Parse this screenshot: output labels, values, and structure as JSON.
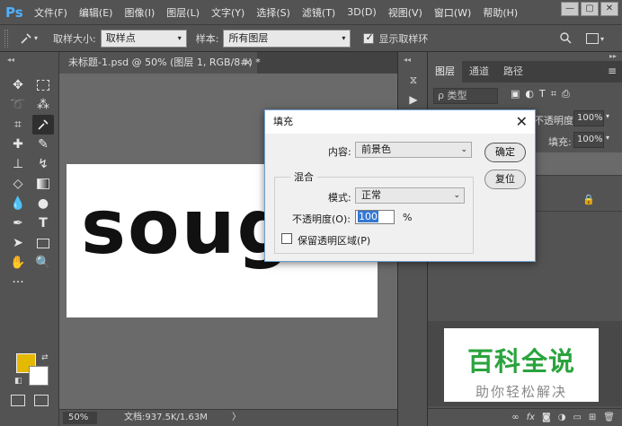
{
  "app": {
    "logo": "Ps"
  },
  "menu": [
    "文件(F)",
    "编辑(E)",
    "图像(I)",
    "图层(L)",
    "文字(Y)",
    "选择(S)",
    "滤镜(T)",
    "3D(D)",
    "视图(V)",
    "窗口(W)",
    "帮助(H)"
  ],
  "window_controls": {
    "minimize": "—",
    "restore": "▢",
    "close": "✕"
  },
  "options": {
    "sample_size_label": "取样大小:",
    "sample_size_value": "取样点",
    "sample_label": "样本:",
    "sample_value": "所有图层",
    "show_ring_label": "显示取样环"
  },
  "document": {
    "tab_title": "未标题-1.psd @ 50% (图层 1, RGB/8#) *",
    "close": "×",
    "canvas_text": "soug"
  },
  "status": {
    "zoom": "50%",
    "doc_size": "文档:937.5K/1.63M",
    "arrow": "〉"
  },
  "colors": {
    "foreground": "#e5b900",
    "background": "#ffffff"
  },
  "layers_panel": {
    "tabs": [
      "图层",
      "通道",
      "路径"
    ],
    "kind_placeholder": "ρ 类型",
    "opacity_label": "不透明度:",
    "opacity_value": "100%",
    "fill_label": "填充:",
    "fill_value": "100%",
    "footer_icons": [
      "link-icon",
      "fx-icon",
      "mask-icon",
      "adjustment-icon",
      "group-icon",
      "new-layer-icon",
      "trash-icon"
    ]
  },
  "fill_dialog": {
    "title": "填充",
    "close": "✕",
    "contents_label": "内容:",
    "contents_value": "前景色",
    "blending_group": "混合",
    "mode_label": "模式:",
    "mode_value": "正常",
    "opacity_label": "不透明度(O):",
    "opacity_value": "100",
    "opacity_unit": "%",
    "preserve_transparency_label": "保留透明区域(P)",
    "ok_button": "确定",
    "reset_button": "复位"
  },
  "watermark": {
    "title": "百科全说",
    "subtitle": "助你轻松解决"
  }
}
